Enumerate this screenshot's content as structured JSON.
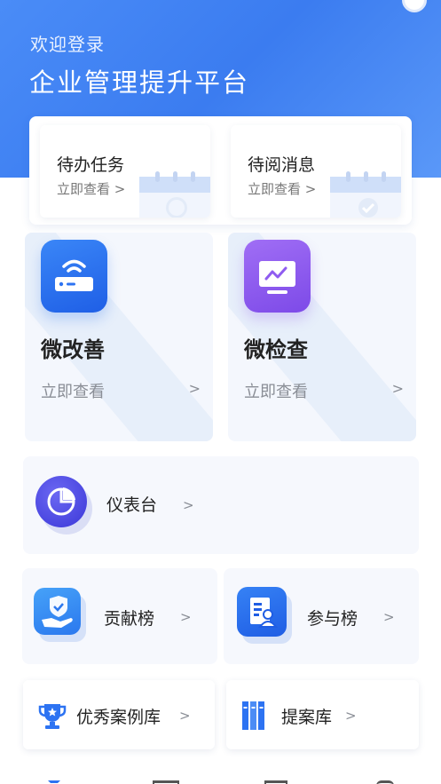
{
  "header": {
    "welcome": "欢迎登录",
    "platform_title": "企业管理提升平台"
  },
  "quick_cards": [
    {
      "title": "待办任务",
      "subtitle": "立即查看 >",
      "icon": "calendar-clock-icon"
    },
    {
      "title": "待阅消息",
      "subtitle": "立即查看 >",
      "icon": "calendar-check-icon"
    }
  ],
  "feature_cards": [
    {
      "title": "微改善",
      "subtitle": "立即查看",
      "arrow": ">",
      "icon": "router-icon"
    },
    {
      "title": "微检查",
      "subtitle": "立即查看",
      "arrow": ">",
      "icon": "monitor-chart-icon"
    }
  ],
  "dashboard": {
    "title": "仪表台",
    "arrow": ">",
    "icon": "pie-chart-icon"
  },
  "rank_cards": [
    {
      "title": "贡献榜",
      "arrow": ">",
      "icon": "hand-shield-icon"
    },
    {
      "title": "参与榜",
      "arrow": ">",
      "icon": "user-document-icon"
    }
  ],
  "library_cards": [
    {
      "title": "优秀案例库",
      "arrow": ">",
      "icon": "trophy-icon"
    },
    {
      "title": "提案库",
      "arrow": ">",
      "icon": "binders-icon"
    }
  ],
  "colors": {
    "header_blue": "#3f82f4",
    "blue_icon": "#2d73f2",
    "purple_icon": "#8f5cf0",
    "indigo_icon": "#4d4ae6",
    "card_bg": "#f6f8fd"
  }
}
